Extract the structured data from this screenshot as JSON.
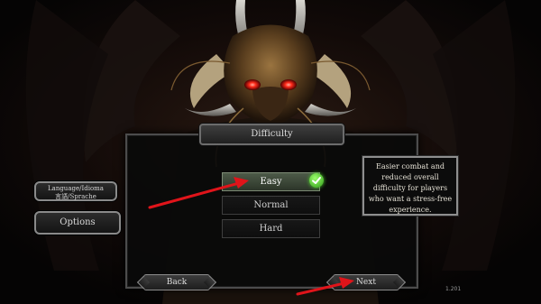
{
  "dialog": {
    "title": "Difficulty",
    "options": [
      {
        "label": "Easy",
        "selected": true
      },
      {
        "label": "Normal",
        "selected": false
      },
      {
        "label": "Hard",
        "selected": false
      }
    ],
    "description": "Easier combat and reduced overall difficulty for players who want a stress-free experience."
  },
  "side_menu": {
    "language_label_line1": "Language/Idioma",
    "language_label_line2": "言語/Sprache",
    "options_label": "Options"
  },
  "footer": {
    "back_label": "Back",
    "next_label": "Next",
    "version": "1.201"
  },
  "colors": {
    "selected_fill": "#4d5a48",
    "check_green": "#3fbf1f",
    "annotation_arrow": "#e0141a",
    "dragon_eye": "#ff2a1a"
  },
  "icons": {
    "check": "green-checkmark-icon",
    "arrow": "red-annotation-arrow"
  }
}
